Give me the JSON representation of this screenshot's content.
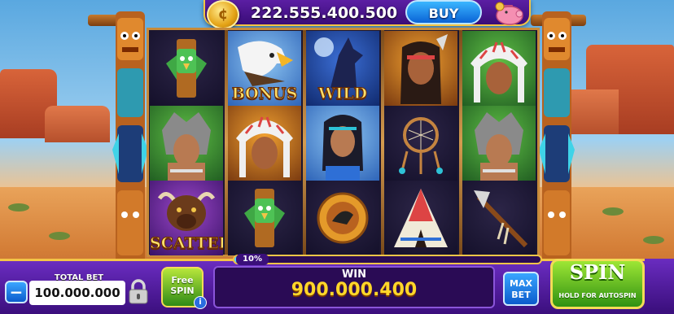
{
  "topbar": {
    "balance": "222.555.400.500",
    "buy_label": "BUY",
    "coin_icon": "coin-icon",
    "piggy_icon": "piggy-bank-icon"
  },
  "reels": {
    "columns": [
      [
        {
          "symbol": "totem",
          "label": ""
        },
        {
          "symbol": "wolf-warrior",
          "label": ""
        },
        {
          "symbol": "buffalo",
          "label": "SCATTER"
        }
      ],
      [
        {
          "symbol": "eagle",
          "label": "BONUS"
        },
        {
          "symbol": "chief",
          "label": ""
        },
        {
          "symbol": "totem",
          "label": ""
        }
      ],
      [
        {
          "symbol": "howling-wolf",
          "label": "WILD"
        },
        {
          "symbol": "native-woman",
          "label": ""
        },
        {
          "symbol": "shield-emblem",
          "label": ""
        }
      ],
      [
        {
          "symbol": "warrior",
          "label": ""
        },
        {
          "symbol": "dreamcatcher",
          "label": ""
        },
        {
          "symbol": "teepee",
          "label": ""
        }
      ],
      [
        {
          "symbol": "chief",
          "label": ""
        },
        {
          "symbol": "wolf-warrior",
          "label": ""
        },
        {
          "symbol": "tomahawk",
          "label": ""
        }
      ]
    ]
  },
  "progress": {
    "text": "10%",
    "value": 0.1
  },
  "bottombar": {
    "total_bet_label": "TOTAL BET",
    "total_bet_value": "100.000.000",
    "minus_label": "−",
    "free_spin_label_1": "Free",
    "free_spin_label_2": "SPIN",
    "info_label": "i",
    "win_label": "WIN",
    "win_amount": "900.000.400",
    "max_bet_label_1": "MAX",
    "max_bet_label_2": "BET",
    "spin_label": "SPIN",
    "spin_sub_label": "HOLD FOR AUTOSPIN"
  },
  "colors": {
    "accent_gold": "#f3c547",
    "bar_purple": "#4a1596",
    "spin_green": "#5cc223",
    "win_yellow": "#ffd72a"
  }
}
